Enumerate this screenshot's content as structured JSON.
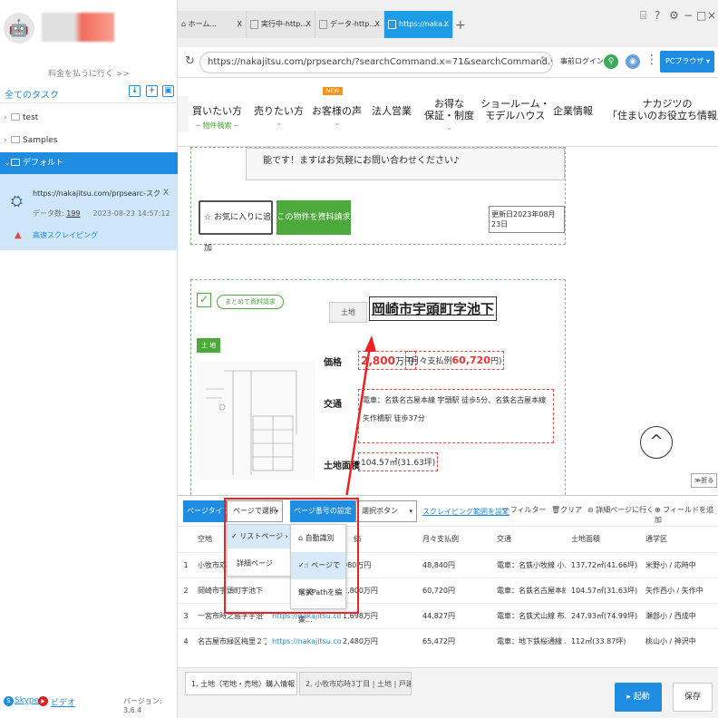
{
  "sidebar": {
    "pay_link": "料金を払うに行く >>",
    "all_tasks": "全てのタスク",
    "tree": [
      {
        "chevron": "›",
        "label": "test"
      },
      {
        "chevron": "›",
        "label": "Samples"
      },
      {
        "chevron": "⌄",
        "label": "デフォルト"
      }
    ],
    "task": {
      "url": "https://nakajitsu.com/prpsearc-スクレイピン...",
      "count_label": "データ数:",
      "count": "199",
      "timestamp": "2023-08-23 14:57:12",
      "mode": "高速スクレイピング",
      "close": "X"
    },
    "footer": {
      "skype": "Skype",
      "video": "ビデオ",
      "version": "バージョン: 3.6.4"
    }
  },
  "browser": {
    "tabs": [
      {
        "label": "ホーム...",
        "close": "X"
      },
      {
        "label": "実行中-http...",
        "close": "X"
      },
      {
        "label": "データ-http...",
        "close": "X"
      },
      {
        "label": "https://naka...",
        "close": "X"
      }
    ],
    "new_tab": "+",
    "url": "https://nakajitsu.com/prpsearch/?searchCommand.x=71&searchCommand.y=28&SYUBET...",
    "login": "事前ログイン",
    "mode_button": "PCブラウザ"
  },
  "site": {
    "nav": [
      {
        "label": "買いたい方",
        "sub": "─ 物件検索 ─"
      },
      {
        "label": "売りたい方",
        "sub": ""
      },
      {
        "label": "お客様の声",
        "sub": "",
        "badge": "NEW"
      },
      {
        "label": "法人営業",
        "sub": ""
      },
      {
        "label": "お得な\n保証・制度",
        "sub": ""
      },
      {
        "label": "ショールーム・\nモデルハウス",
        "sub": ""
      },
      {
        "label": "企業情報",
        "sub": ""
      },
      {
        "label": "ナカジツの\n「住まいのお役立ち情報」",
        "sub": ""
      }
    ],
    "new_badge": "NEW",
    "notice": "能です！ますはお気軽にお問い合わせください♪",
    "fav_button": "お気に入りに追加",
    "request_button": "この物件を資料請求",
    "updated": "更新日2023年08月23日",
    "bulk_request": "まとめて資料請求",
    "land_tag": "土 地",
    "property": {
      "type": "土地",
      "title": "岡崎市宇頭町字池下",
      "price_label": "価格",
      "price": "2,800",
      "price_unit": "万円",
      "monthly_prefix": "(月々支払例",
      "monthly": "60,720",
      "monthly_suffix": "円)",
      "access_label": "交通",
      "access": "電車：名鉄名古屋本線 宇頭駅 徒歩5分、名鉄名古屋本線 矢作橋駅 徒歩37分",
      "area_label": "土地面積",
      "area": "104.57㎡(31.63坪)"
    },
    "collapse": "≫折る"
  },
  "config": {
    "page_type": "ページタイプ",
    "page_select": "ページで選択",
    "page_number": "ページ番号の設定",
    "select_button": "選択ボタン",
    "scrape_range": "スクレイピング範囲を設定",
    "filter": "フィルター",
    "clear": "クリア",
    "detail": "詳細ページに行く",
    "add_field": "フィールドを追加",
    "menu1": [
      "リストページ",
      "詳細ページ"
    ],
    "menu2": [
      "自動識別",
      "ページで選択",
      "XPathを編集..."
    ],
    "columns": [
      "空地",
      "",
      "価",
      "月々支払例",
      "交通",
      "土地面積",
      "通学区"
    ],
    "rows": [
      [
        "1",
        "小牧市応時",
        "",
        "980万円",
        "48,840円",
        "電車：名鉄小牧線 小...",
        "137.72㎡(41.66坪)",
        "米野小 / 応時中"
      ],
      [
        "2",
        "岡崎市宇頭町字池下",
        "",
        "2,800万円",
        "60,720円",
        "電車：名鉄名古屋本線...",
        "104.57㎡(31.63坪)",
        "矢作西小 / 矢作中"
      ],
      [
        "3",
        "一宮市時之島字宇治",
        "https://nakajitsu.com/pr...",
        "1,698万円",
        "44,827円",
        "電車：名鉄犬山線 布...",
        "247.93㎡(74.99坪)",
        "瀬部小 / 西成中"
      ],
      [
        "4",
        "名古屋市緑区梅里２丁目",
        "https://nakajitsu.com/pr...",
        "2,480万円",
        "65,472円",
        "電車：地下鉄桜通線 ...",
        "112㎡(33.87坪)",
        "桃山小 / 神沢中"
      ]
    ]
  },
  "bottom_tabs": [
    {
      "label": "1. 土地（宅地・売地）購入情報【..."
    },
    {
      "label": "2. 小牧市応時3丁目 | 土地 | 戸建..."
    }
  ],
  "start_button": "起動",
  "save_button": "保存"
}
